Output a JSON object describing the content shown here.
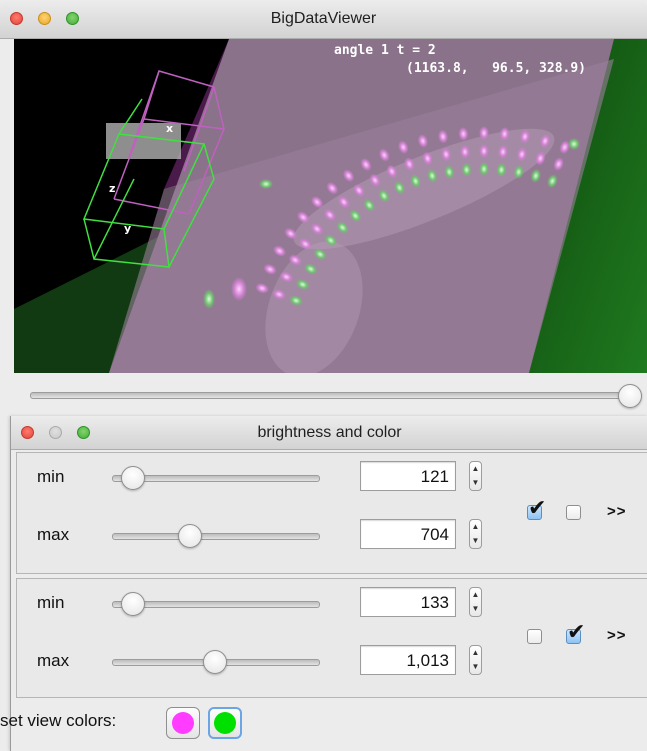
{
  "main_window": {
    "title": "BigDataViewer",
    "overlay": {
      "source_line": "angle 1 t = 2",
      "coords_line": "(1163.8,   96.5, 328.9)"
    },
    "axis_labels": {
      "x": "x",
      "y": "y",
      "z": "z"
    },
    "time_slider": {
      "value_fraction": 1.0
    }
  },
  "brightness_window": {
    "title": "brightness and color",
    "groups": [
      {
        "min_label": "min",
        "min_value": "121",
        "min_slider_fraction": 0.05,
        "max_label": "max",
        "max_value": "704",
        "max_slider_fraction": 0.36,
        "checkbox_1_checked": true,
        "checkbox_2_checked": false,
        "expand_label": ">>"
      },
      {
        "min_label": "min",
        "min_value": "133",
        "min_slider_fraction": 0.05,
        "max_label": "max",
        "max_value": "1,013",
        "max_slider_fraction": 0.5,
        "checkbox_1_checked": false,
        "checkbox_2_checked": true,
        "expand_label": ">>"
      }
    ],
    "set_view_colors_label": "set view colors:",
    "colors": [
      "#ff3cff",
      "#00e000"
    ]
  },
  "icons": {
    "close": "close-icon",
    "minimize": "minimize-icon",
    "zoom": "zoom-icon",
    "stepper": "stepper-arrows-icon",
    "check": "checkmark-icon"
  }
}
